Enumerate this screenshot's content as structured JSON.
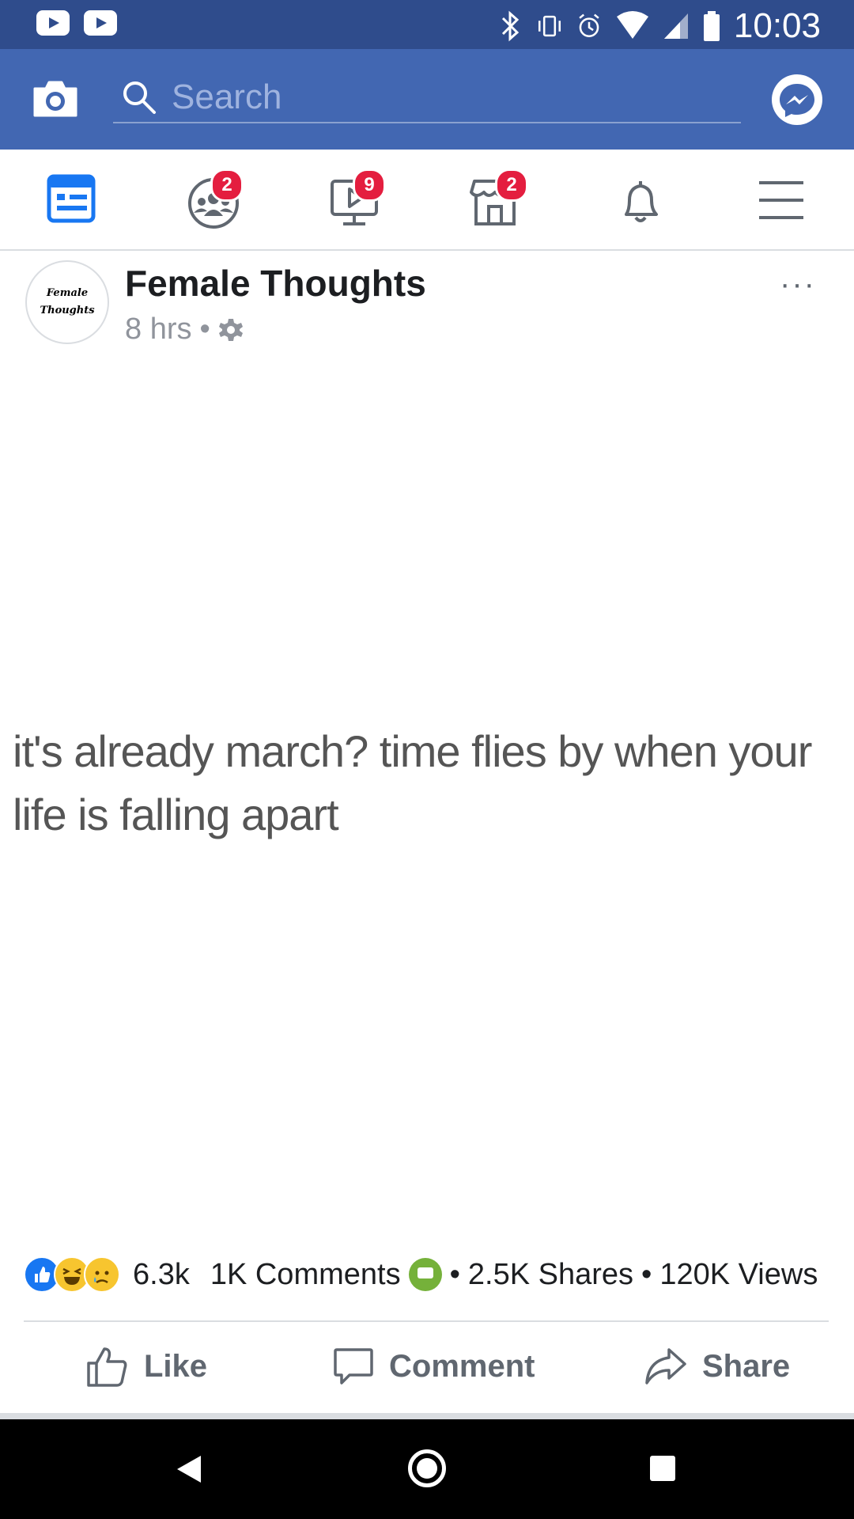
{
  "status_bar": {
    "time": "10:03"
  },
  "header": {
    "search_placeholder": "Search"
  },
  "nav": {
    "groups_badge": "2",
    "watch_badge": "9",
    "marketplace_badge": "2"
  },
  "post": {
    "author": "Female Thoughts",
    "avatar_line1": "Female",
    "avatar_line2": "Thoughts",
    "time": "8 hrs",
    "separator": "•",
    "more": "···",
    "text": "it's already march? time flies by when your life is falling apart"
  },
  "stats": {
    "reactions_count": "6.3k",
    "comments": "1K Comments",
    "dot1": "•",
    "shares": "2.5K Shares",
    "dot2": "•",
    "views": "120K Views"
  },
  "actions": {
    "like": "Like",
    "comment": "Comment",
    "share": "Share"
  },
  "colors": {
    "brand": "#4267b2",
    "status_bar": "#2f4c8c",
    "badge": "#e41e3f",
    "nav_active": "#1877f2"
  }
}
